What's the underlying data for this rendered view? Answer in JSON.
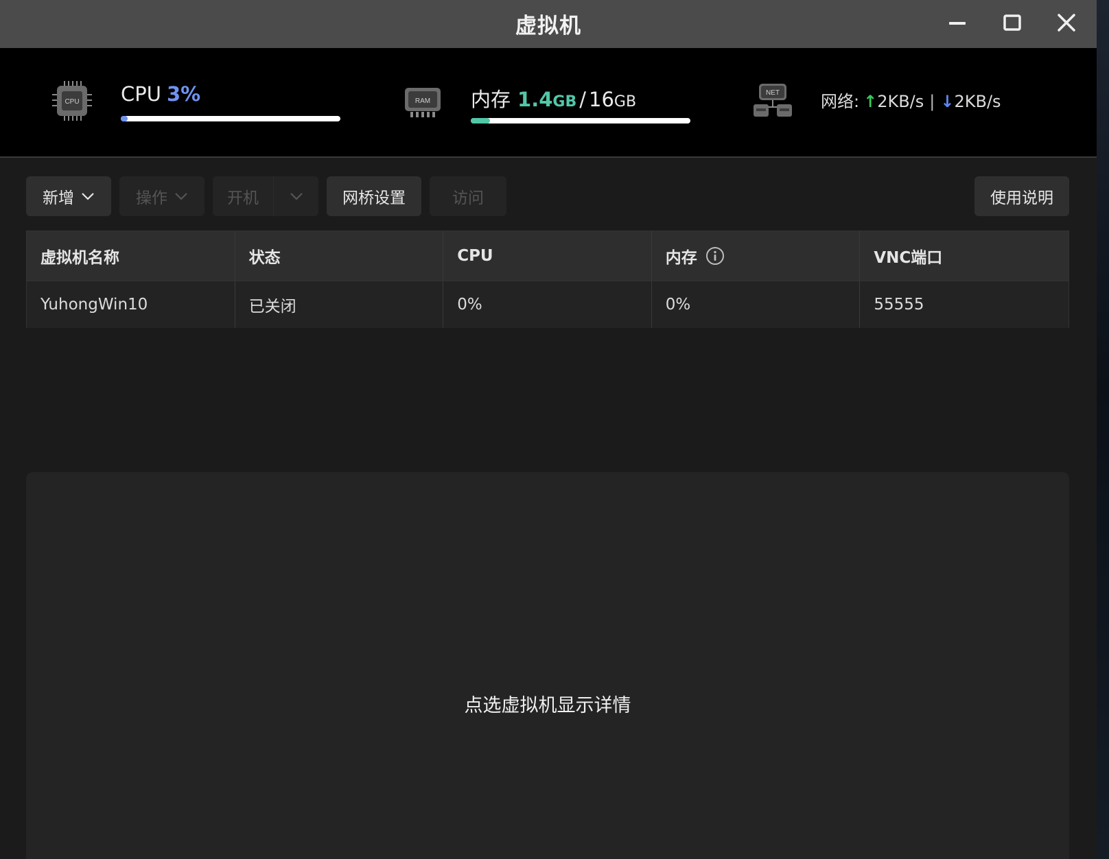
{
  "window": {
    "title": "虚拟机",
    "controls": {
      "minimize": "minimize",
      "maximize": "maximize",
      "close": "close"
    }
  },
  "stats": {
    "cpu": {
      "icon": "cpu-icon",
      "label": "CPU",
      "value": "3%",
      "usage_fraction": 0.03,
      "chip_text": "CPU"
    },
    "memory": {
      "icon": "ram-icon",
      "label": "内存",
      "used": "1.4",
      "used_unit": "GB",
      "separator": "/",
      "total": "16",
      "total_unit": "GB",
      "usage_fraction": 0.0875,
      "chip_text": "RAM"
    },
    "network": {
      "icon": "net-icon",
      "label": "网络:",
      "up_arrow": "↑",
      "up": "2KB/s",
      "divider": "|",
      "down_arrow": "↓",
      "down": "2KB/s",
      "chip_text": "NET"
    }
  },
  "toolbar": {
    "add": "新增",
    "operations": "操作",
    "start": "开机",
    "bridge": "网桥设置",
    "visit": "访问",
    "help": "使用说明"
  },
  "table": {
    "headers": [
      "虚拟机名称",
      "状态",
      "CPU",
      "内存",
      "VNC端口"
    ],
    "rows": [
      [
        "YuhongWin10",
        "已关闭",
        "0%",
        "0%",
        "55555"
      ]
    ]
  },
  "details": {
    "hint": "点选虚拟机显示详情"
  },
  "colors": {
    "cpu_accent": "#6f93f0",
    "mem_accent": "#52c7a8",
    "net_up": "#39c85b",
    "net_down": "#5d86f5"
  }
}
